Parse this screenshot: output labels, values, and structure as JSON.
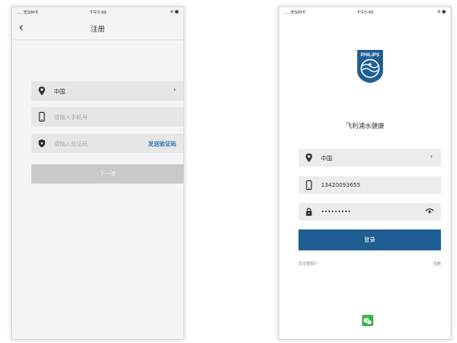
{
  "left_screen": {
    "status": {
      "carrier": ".... 无SIM卡",
      "time": "下午5:49",
      "battery": "⊕ ■"
    },
    "nav": {
      "back_icon": "chevron-left-icon",
      "title": "注册"
    },
    "country_field": {
      "value": "中国",
      "icon": "location-pin-icon"
    },
    "phone_field": {
      "placeholder": "请输入手机号",
      "icon": "phone-icon"
    },
    "code_field": {
      "placeholder": "请输入验证码",
      "icon": "shield-icon",
      "send_label": "发送验证码"
    },
    "next_button": {
      "label": "下一步"
    },
    "colors": {
      "link": "#2f78b5",
      "disabled_button": "#c9c9c9"
    }
  },
  "right_screen": {
    "status": {
      "carrier": ".... 无SIM卡",
      "time": "下午5:49",
      "battery": "⊕ ■"
    },
    "logo": {
      "text": "PHILIPS"
    },
    "brand_name": "飞利浦水健康",
    "country_field": {
      "value": "中国",
      "icon": "location-pin-icon"
    },
    "phone_field": {
      "value": "13420093655",
      "icon": "phone-icon"
    },
    "password_field": {
      "value": "•••••••••",
      "icon": "lock-icon",
      "toggle_icon": "eye-icon"
    },
    "login_button": {
      "label": "登录"
    },
    "forgot_password": "忘记密码?",
    "register_link": "注册",
    "wechat_icon": "wechat-icon",
    "colors": {
      "primary": "#1f5e92",
      "wechat": "#3bb44a"
    }
  }
}
